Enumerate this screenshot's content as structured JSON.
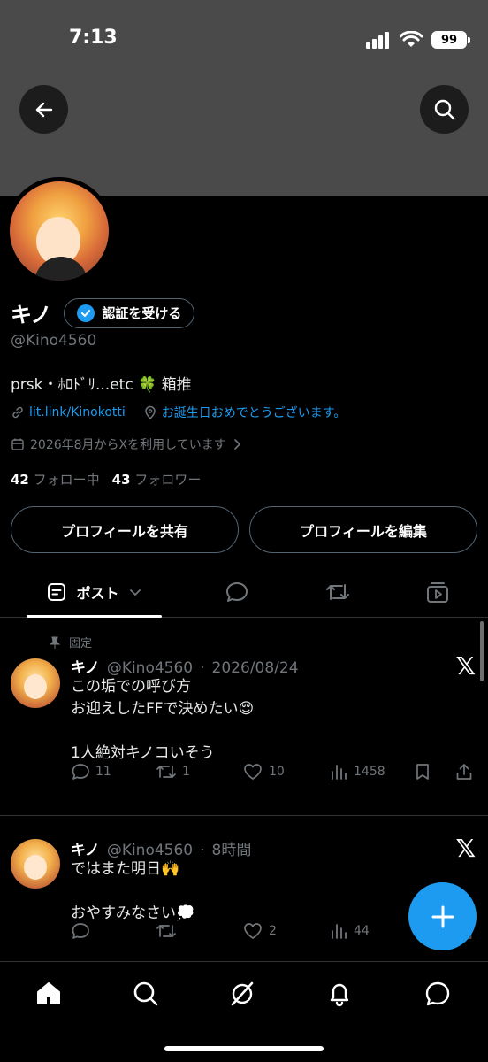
{
  "status_bar": {
    "time": "7:13",
    "battery": "99"
  },
  "header": {
    "back_label": "back",
    "search_label": "search"
  },
  "profile": {
    "display_name": "キノ",
    "verify_label": "認証を受ける",
    "handle": "@Kino4560",
    "bio": "prsk・ﾎﾛﾄﾞﾘ...etc 🍀 箱推",
    "link": "lit.link/Kinokotti",
    "location": "お誕生日おめでとうございます。",
    "joined": "2026年8月からXを利用しています",
    "following_count": "42",
    "following_label": "フォロー中",
    "followers_count": "43",
    "followers_label": "フォロワー",
    "share_label": "プロフィールを共有",
    "edit_label": "プロフィールを編集"
  },
  "tabs": {
    "posts_label": "ポスト"
  },
  "posts": [
    {
      "pinned_label": "固定",
      "name": "キノ",
      "handle": "@Kino4560",
      "time": "2026/08/24",
      "lines": [
        "この垢での呼び方",
        "お迎えしたFFで決めたい😌",
        "",
        "1人絶対キノコいそう"
      ],
      "replies": "11",
      "reposts": "1",
      "likes": "10",
      "views": "1458"
    },
    {
      "name": "キノ",
      "handle": "@Kino4560",
      "time": "8時間",
      "lines": [
        "ではまた明日🙌",
        "",
        "おやすみなさい💭"
      ],
      "replies": "",
      "reposts": "",
      "likes": "2",
      "views": "44"
    }
  ],
  "colors": {
    "accent": "#1d9bf0",
    "muted": "#71767b",
    "banner": "#4a4a4a",
    "background": "#000000"
  },
  "icons": [
    "back-arrow-icon",
    "search-icon",
    "verified-badge-icon",
    "link-icon",
    "location-icon",
    "calendar-icon",
    "chevron-right-icon",
    "posts-icon",
    "chevron-down-icon",
    "reply-icon",
    "repost-icon",
    "media-icon",
    "pin-icon",
    "x-logo-icon",
    "like-icon",
    "views-icon",
    "bookmark-icon",
    "share-icon",
    "plus-icon",
    "home-icon",
    "grok-icon",
    "notifications-icon",
    "messages-icon"
  ]
}
